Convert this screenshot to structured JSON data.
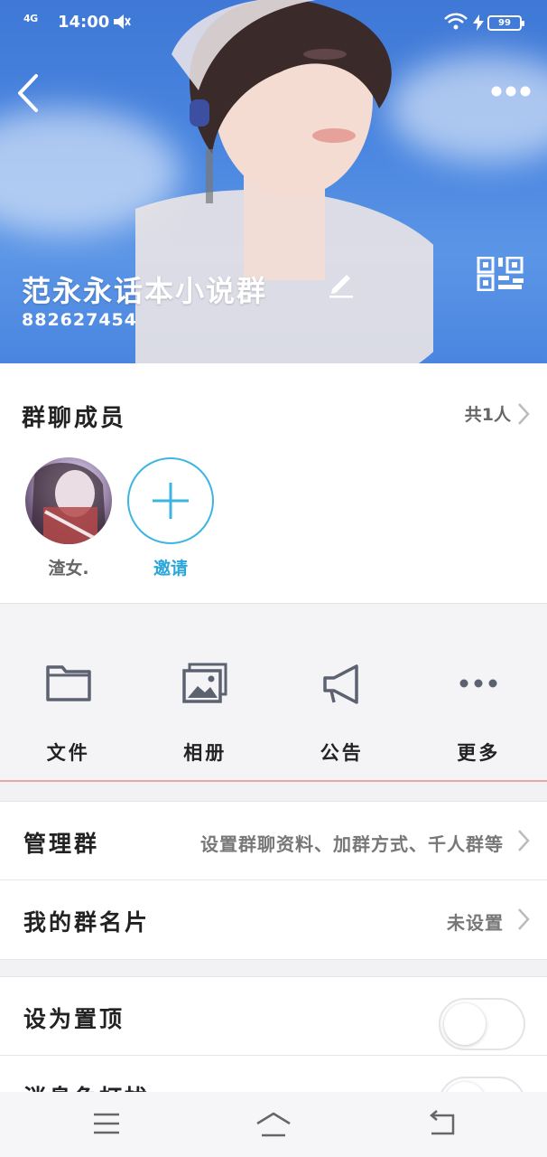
{
  "status_bar": {
    "network": "4G",
    "time": "14:00",
    "battery": "99"
  },
  "header": {
    "group_name": "范永永话本小说群",
    "group_id": "882627454",
    "icons": [
      "back-arrow-icon",
      "more-dots-icon",
      "edit-pencil-icon",
      "qr-code-icon"
    ]
  },
  "members": {
    "title": "群聊成员",
    "count_label": "共1人",
    "member_name": "渣女.",
    "invite_label": "邀请"
  },
  "shortcuts": [
    {
      "label": "文件",
      "icon": "folder-icon"
    },
    {
      "label": "相册",
      "icon": "photo-album-icon"
    },
    {
      "label": "公告",
      "icon": "megaphone-icon"
    },
    {
      "label": "更多",
      "icon": "more-dots-icon"
    }
  ],
  "settings": {
    "manage_label": "管理群",
    "manage_value": "设置群聊资料、加群方式、千人群等",
    "card_label": "我的群名片",
    "card_value": "未设置",
    "pin_label": "设为置顶",
    "pin_on": false,
    "dnd_label": "消息免打扰",
    "dnd_on": false
  },
  "navigation": {
    "icons": [
      "menu-icon",
      "home-icon",
      "back-icon"
    ]
  },
  "colors": {
    "accent": "#2aa6d8",
    "header_blue": "#4a86e0"
  }
}
